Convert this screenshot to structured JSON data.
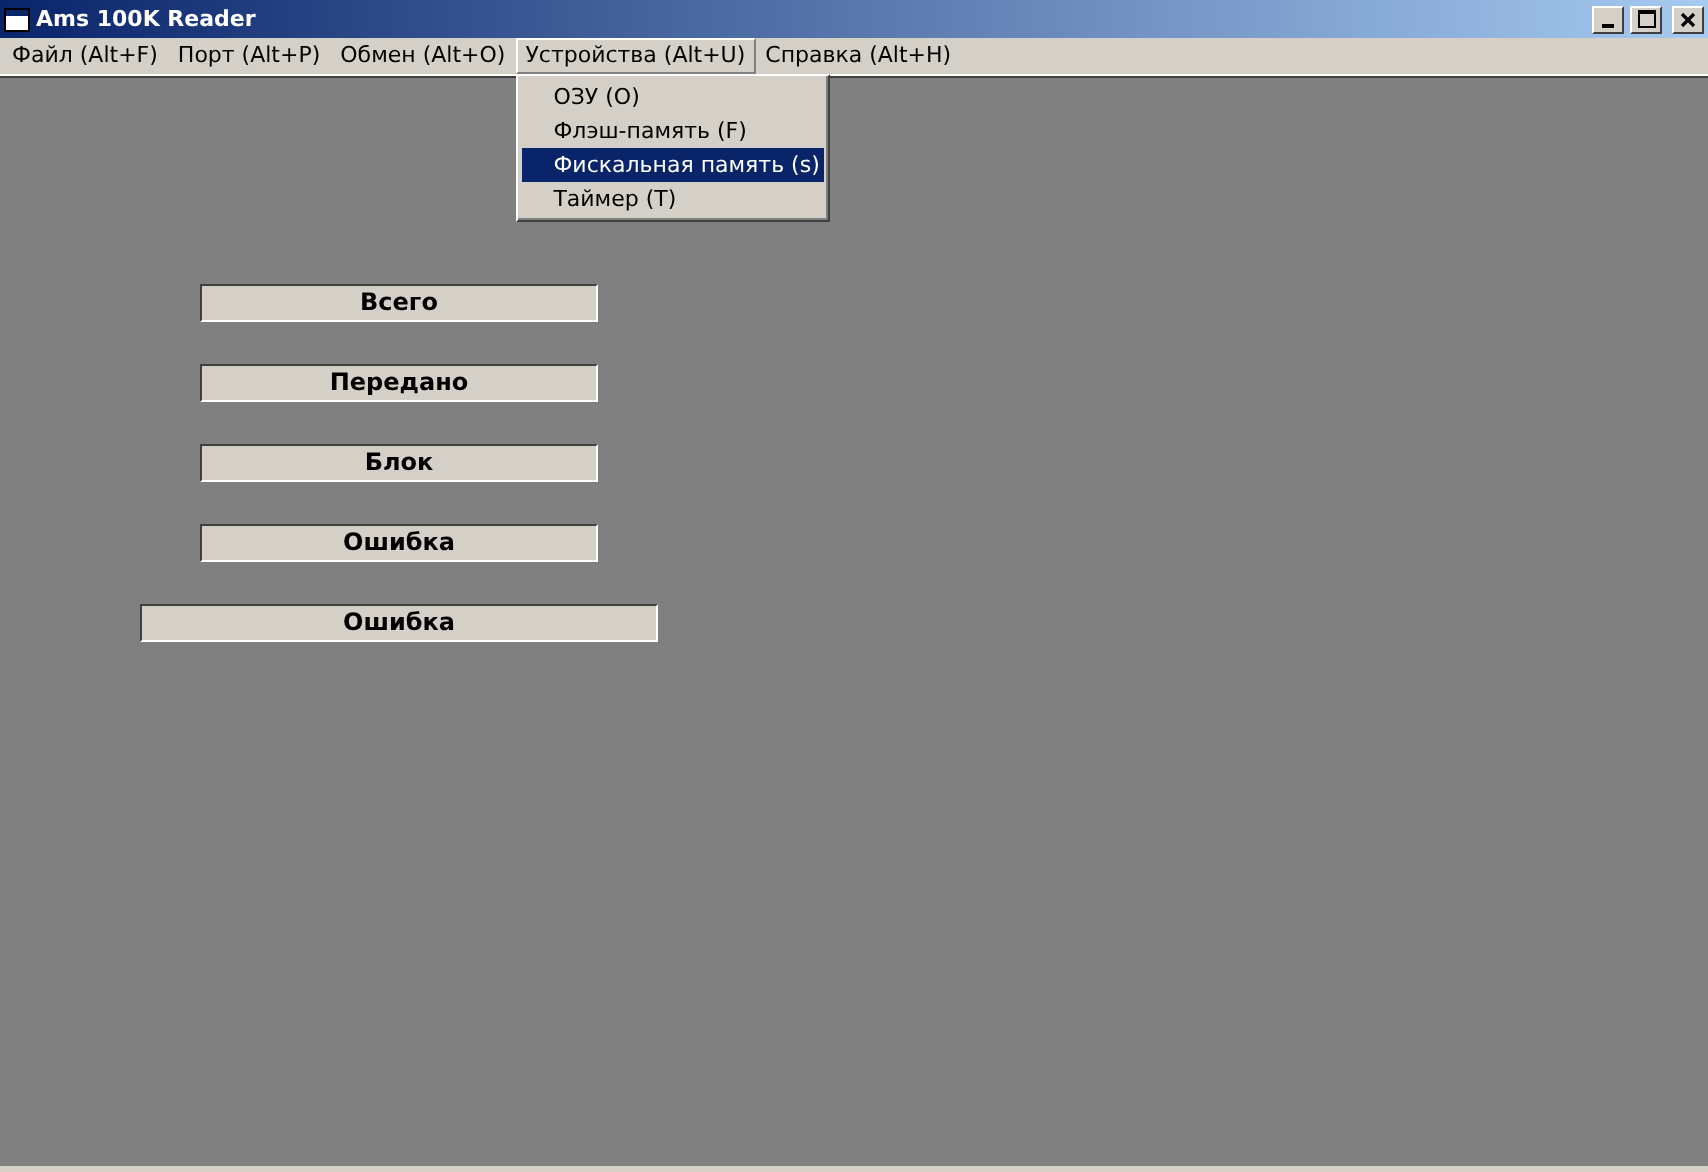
{
  "window": {
    "title": "Ams 100K Reader"
  },
  "menu": [
    {
      "label": "Файл (Alt+F)",
      "selected": false
    },
    {
      "label": "Порт (Alt+P)",
      "selected": false
    },
    {
      "label": "Обмен (Alt+O)",
      "selected": false
    },
    {
      "label": "Устройства (Alt+U)",
      "selected": true,
      "items": [
        {
          "label": "ОЗУ (O)",
          "selected": false
        },
        {
          "label": "Флэш-память (F)",
          "selected": false
        },
        {
          "label": "Фискальная память (s)",
          "selected": true
        },
        {
          "label": "Таймер (T)",
          "selected": false
        }
      ]
    },
    {
      "label": "Справка (Alt+H)",
      "selected": false
    }
  ],
  "panels": [
    {
      "label": "Всего",
      "kind": "short"
    },
    {
      "label": "Передано",
      "kind": "short"
    },
    {
      "label": "Блок",
      "kind": "short"
    },
    {
      "label": "Ошибка",
      "kind": "short"
    },
    {
      "label": "Ошибка",
      "kind": "long"
    }
  ]
}
